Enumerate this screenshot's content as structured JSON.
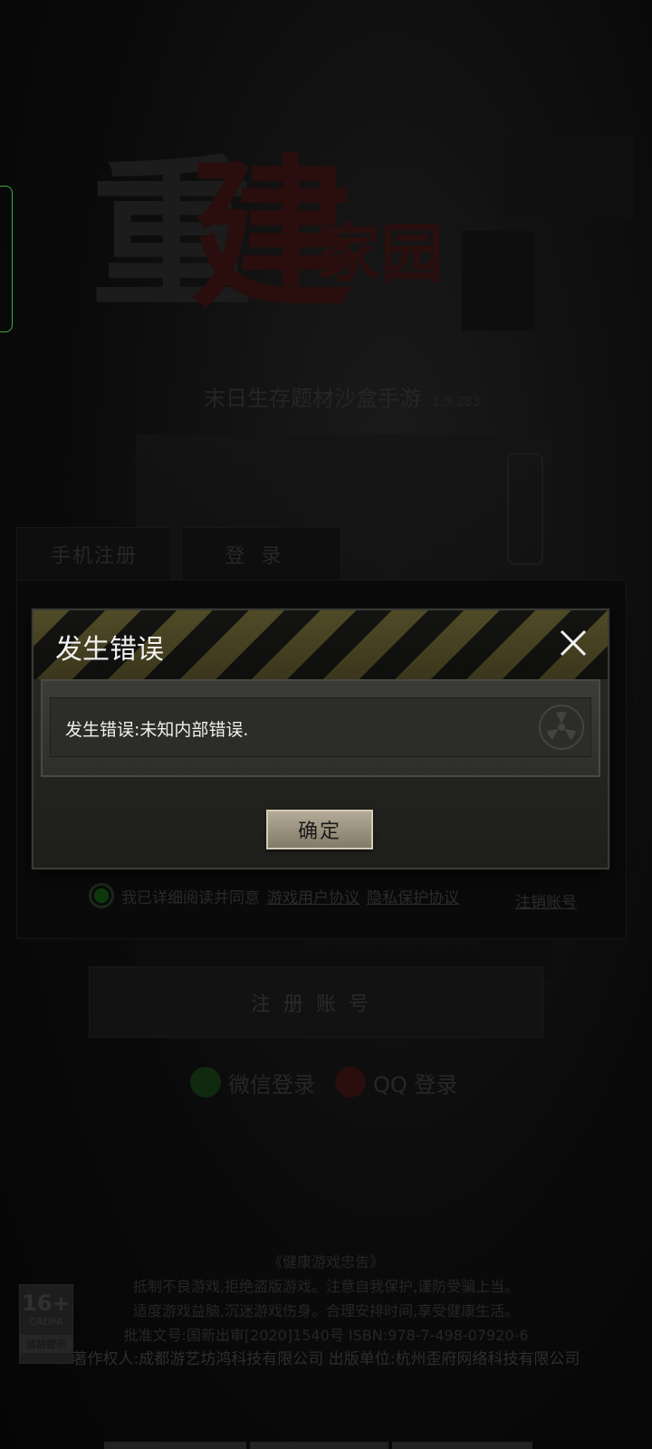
{
  "logo": {
    "char1": "重",
    "char2": "建",
    "chars_small": "家园"
  },
  "subtitle": "末日生存题材沙盒手游",
  "version": "1.9.283",
  "tabs": {
    "register": "手机注册",
    "login": "登录"
  },
  "agreement": {
    "prefix": "我已详细阅读并同意",
    "user_agreement": "游戏用户协议",
    "privacy_agreement": "隐私保护协议",
    "cancel_account": "注销账号"
  },
  "register_button": "注册账号",
  "social": {
    "wechat": "微信登录",
    "qq": "QQ 登录"
  },
  "footer": {
    "heading": "《健康游戏忠告》",
    "line1": "抵制不良游戏,拒绝盗版游戏。注意自我保护,谨防受骗上当。",
    "line2": "适度游戏益脑,沉迷游戏伤身。合理安排时间,享受健康生活。",
    "line3": "批准文号:国新出审[2020]1540号   ISBN:978-7-498-07920-6",
    "line4": "著作权人:成都游艺坊鸿科技有限公司 出版单位:杭州歪府网络科技有限公司"
  },
  "rating": {
    "age": "16+",
    "org": "CADPA",
    "tag": "适龄提示"
  },
  "dialog": {
    "title": "发生错误",
    "message": "发生错误:未知内部错误.",
    "confirm": "确定"
  },
  "icons": {
    "close": "close-icon",
    "wechat": "wechat-icon",
    "qq": "qq-icon",
    "radiation": "radiation-icon"
  },
  "colors": {
    "hazard_yellow": "#6b6333",
    "button_face": "#b3ab97",
    "agree_check": "#0d3a0d"
  }
}
